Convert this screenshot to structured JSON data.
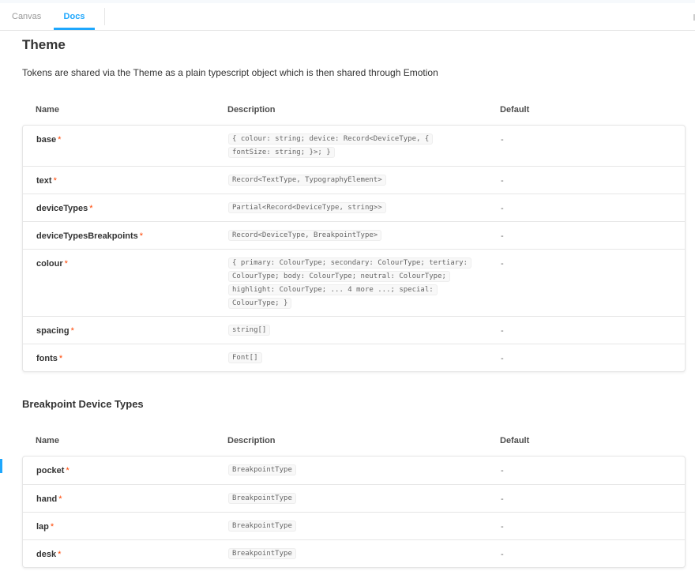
{
  "tabs": [
    {
      "label": "Canvas",
      "active": false
    },
    {
      "label": "Docs",
      "active": true
    }
  ],
  "colors": {
    "accent": "#1ea7fd",
    "required": "#ff4400"
  },
  "theme": {
    "title": "Theme",
    "description": "Tokens are shared via the Theme as a plain typescript object which is then shared through Emotion",
    "headers": {
      "name": "Name",
      "description": "Description",
      "default": "Default"
    },
    "rows": [
      {
        "name": "base",
        "type": "{ colour: string; device: Record<DeviceType, { fontSize: string; }>; }",
        "default": "-"
      },
      {
        "name": "text",
        "type": "Record<TextType, TypographyElement>",
        "default": "-"
      },
      {
        "name": "deviceTypes",
        "type": "Partial<Record<DeviceType, string>>",
        "default": "-"
      },
      {
        "name": "deviceTypesBreakpoints",
        "type": "Record<DeviceType, BreakpointType>",
        "default": "-"
      },
      {
        "name": "colour",
        "type": "{ primary: ColourType; secondary: ColourType; tertiary: ColourType; body: ColourType; neutral: ColourType; highlight: ColourType; ... 4 more ...; special: ColourType; }",
        "default": "-"
      },
      {
        "name": "spacing",
        "type": "string[]",
        "default": "-"
      },
      {
        "name": "fonts",
        "type": "Font[]",
        "default": "-"
      }
    ]
  },
  "breakpoints": {
    "title": "Breakpoint Device Types",
    "headers": {
      "name": "Name",
      "description": "Description",
      "default": "Default"
    },
    "rows": [
      {
        "name": "pocket",
        "type": "BreakpointType",
        "default": "-"
      },
      {
        "name": "hand",
        "type": "BreakpointType",
        "default": "-"
      },
      {
        "name": "lap",
        "type": "BreakpointType",
        "default": "-"
      },
      {
        "name": "desk",
        "type": "BreakpointType",
        "default": "-"
      }
    ]
  },
  "required_mark": "*"
}
